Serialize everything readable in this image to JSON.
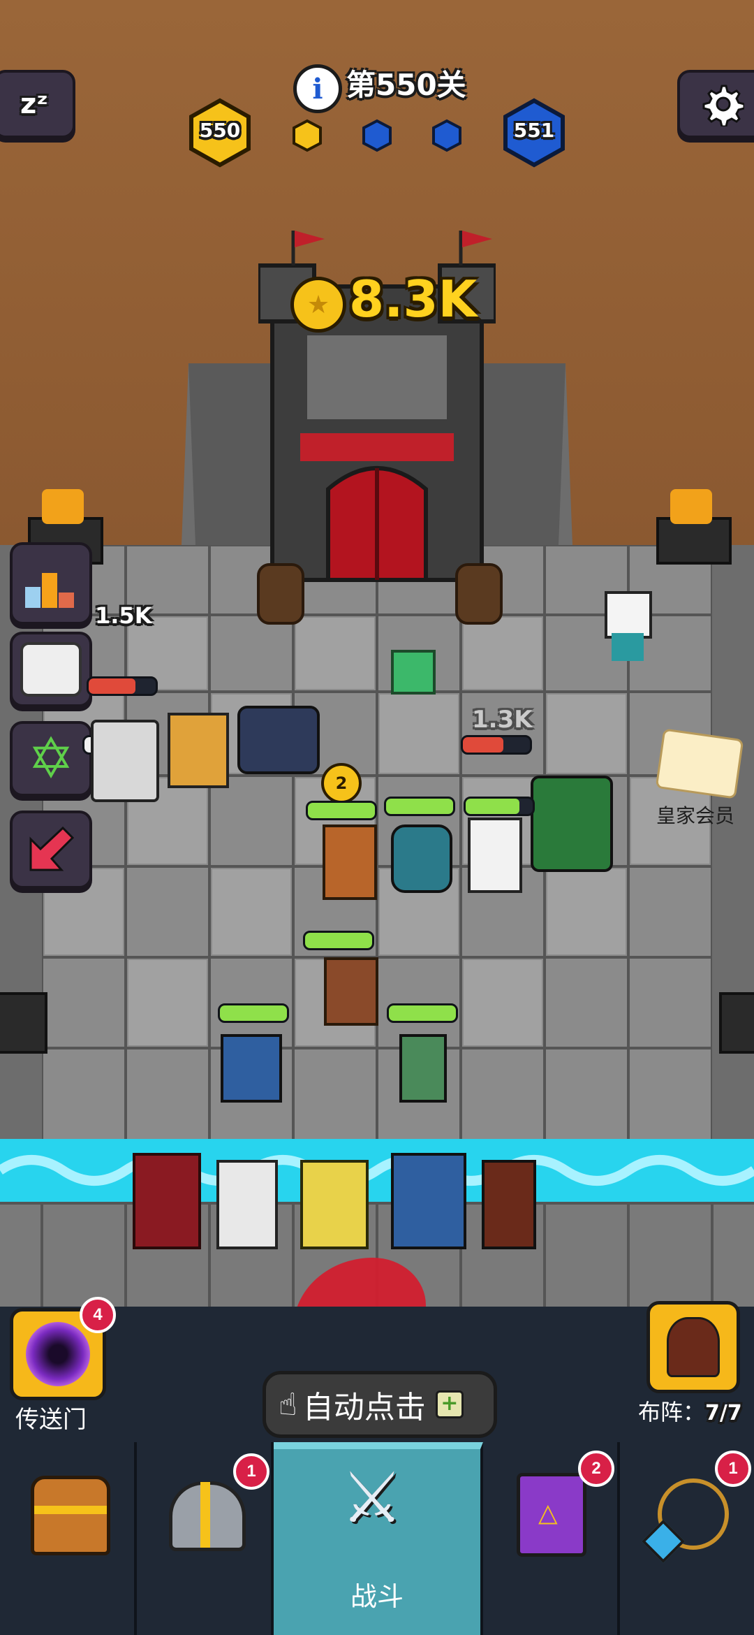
{
  "hud": {
    "level_label": "第550关",
    "level_left": "550",
    "level_right": "551",
    "coins": "8.3K",
    "side_value": "1.5K",
    "royal_member": "皇家会员",
    "floating_damage": "1.3K"
  },
  "bottom": {
    "portal_label": "传送门",
    "portal_badge": "4",
    "auto_click": "自动点击",
    "formation_label": "布阵：",
    "formation_count": "7/7"
  },
  "tabs": [
    {
      "name": "chest",
      "label": "",
      "badge": ""
    },
    {
      "name": "heroes",
      "label": "",
      "badge": "1"
    },
    {
      "name": "battle",
      "label": "战斗",
      "badge": ""
    },
    {
      "name": "spellbook",
      "label": "",
      "badge": "2"
    },
    {
      "name": "amulet",
      "label": "",
      "badge": "1"
    }
  ],
  "colors": {
    "background": "#8a5a34",
    "tab_active": "#4aa3b0",
    "badge": "#d82047",
    "hp_green": "#8fe04a",
    "hp_red": "#e04a3a",
    "water": "#28d4ee",
    "gold_hex": "#f6c21a",
    "blue_hex": "#1f5bd1"
  },
  "units": {
    "star_level": "2"
  }
}
